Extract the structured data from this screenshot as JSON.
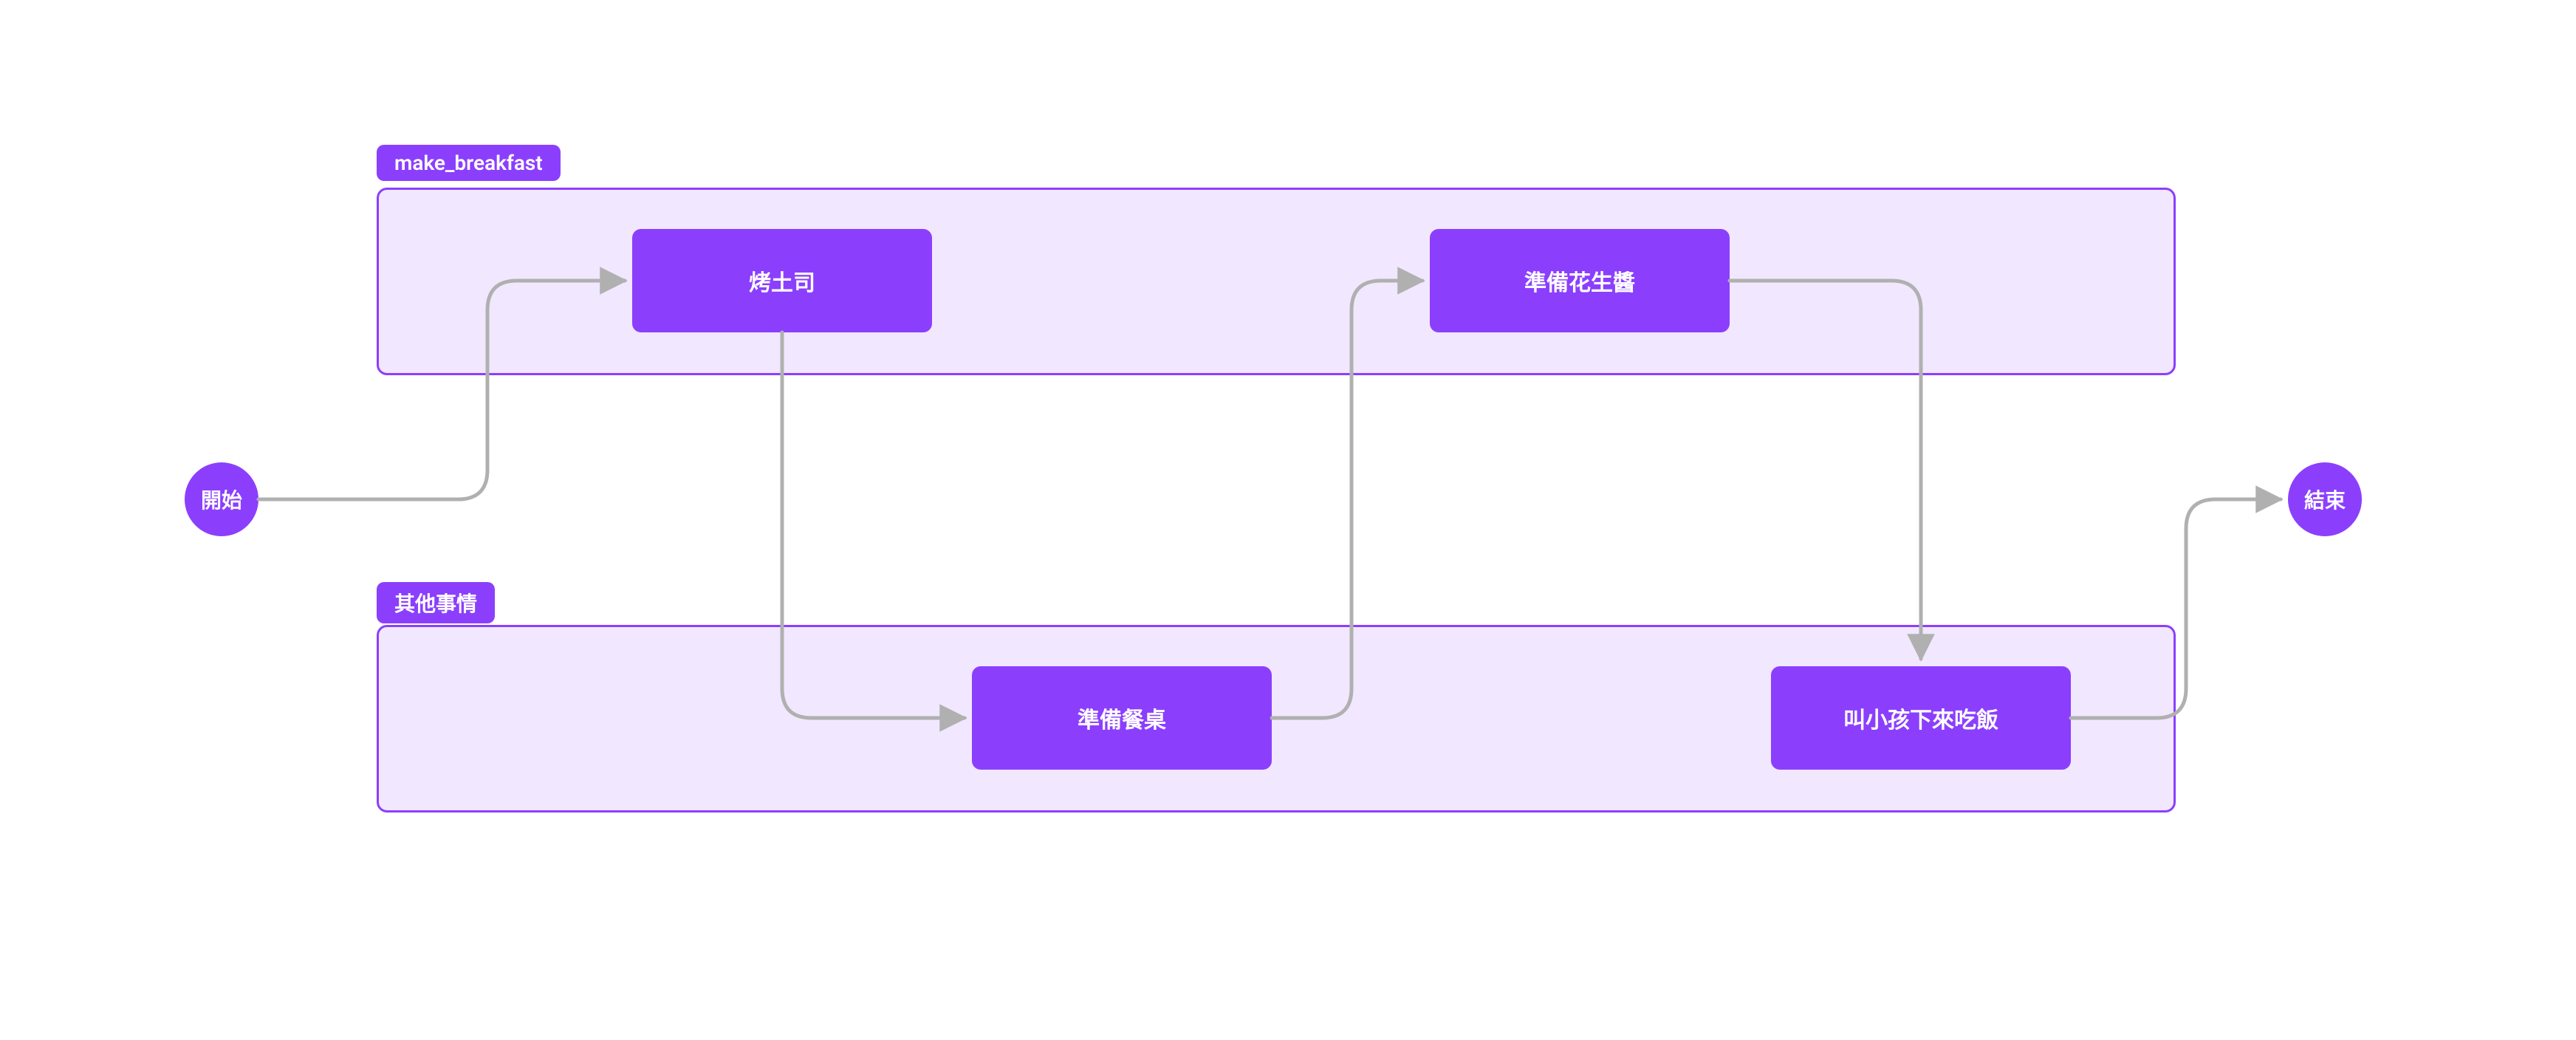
{
  "diagram": {
    "start_label": "開始",
    "end_label": "結束",
    "groups": {
      "top": {
        "label": "make_breakfast"
      },
      "bottom": {
        "label": "其他事情"
      }
    },
    "nodes": {
      "toast": "烤土司",
      "peanut_butter": "準備花生醬",
      "set_table": "準備餐桌",
      "call_kids": "叫小孩下來吃飯"
    },
    "colors": {
      "accent": "#8B3FFD",
      "group_fill": "#F1E7FE",
      "edge": "#B0B0B0"
    }
  },
  "chart_data": {
    "type": "flowchart",
    "direction": "LR",
    "nodes": [
      {
        "id": "start",
        "label": "開始",
        "shape": "circle"
      },
      {
        "id": "toast",
        "label": "烤土司",
        "shape": "rect",
        "group": "make_breakfast"
      },
      {
        "id": "peanut_butter",
        "label": "準備花生醬",
        "shape": "rect",
        "group": "make_breakfast"
      },
      {
        "id": "set_table",
        "label": "準備餐桌",
        "shape": "rect",
        "group": "其他事情"
      },
      {
        "id": "call_kids",
        "label": "叫小孩下來吃飯",
        "shape": "rect",
        "group": "其他事情"
      },
      {
        "id": "end",
        "label": "結束",
        "shape": "circle"
      }
    ],
    "groups": [
      {
        "id": "make_breakfast",
        "label": "make_breakfast"
      },
      {
        "id": "other",
        "label": "其他事情"
      }
    ],
    "edges": [
      {
        "from": "start",
        "to": "toast"
      },
      {
        "from": "toast",
        "to": "set_table"
      },
      {
        "from": "set_table",
        "to": "peanut_butter"
      },
      {
        "from": "peanut_butter",
        "to": "call_kids"
      },
      {
        "from": "call_kids",
        "to": "end"
      }
    ]
  }
}
